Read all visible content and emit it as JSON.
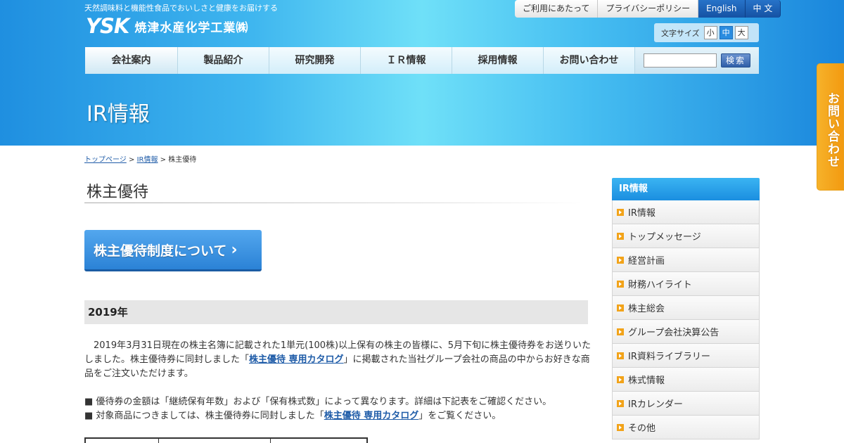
{
  "header": {
    "tagline": "天然調味料と機能性食品でおいしさと健康をお届けする",
    "logo_mark": "YSK",
    "company_name": "焼津水産化学工業㈱",
    "top_links": [
      "ご利用にあたって",
      "プライバシーポリシー",
      "English",
      "中 文"
    ],
    "font_size_label": "文字サイズ",
    "font_sizes": [
      "小",
      "中",
      "大"
    ]
  },
  "global_nav": [
    "会社案内",
    "製品紹介",
    "研究開発",
    "ＩＲ情報",
    "採用情報",
    "お問い合わせ"
  ],
  "search": {
    "placeholder": "",
    "button": "検索"
  },
  "page_title": "IR情報",
  "side_tab": "お問い合わせ",
  "breadcrumb": {
    "home": "トップページ",
    "section": "IR情報",
    "current": "株主優待",
    "sep": ">"
  },
  "main": {
    "heading": "株主優待",
    "cta_label": "株主優待制度について",
    "year": "2019年",
    "para_1": "2019年3月31日現在の株主名簿に記載された1単元(100株)以上保有の株主の皆様に、5月下旬に株主優待券をお送りいたしました。株主優待券に同封しました「",
    "catalog_link": "株主優待 専用カタログ",
    "para_1_end": "」に掲載された当社グループ会社の商品の中からお好きな商品をご注文いただけます。",
    "bullet_1": "■ 優待券の金額は「継続保有年数」および「保有株式数」によって異なります。詳細は下記表をご確認ください。",
    "bullet_2_start": "■ 対象商品につきましては、株主優待券に同封しました「",
    "bullet_2_end": "」をご覧ください。"
  },
  "sidebar": {
    "title": "IR情報",
    "items": [
      "IR情報",
      "トップメッセージ",
      "経営計画",
      "財務ハイライト",
      "株主総会",
      "グループ会社決算公告",
      "IR資料ライブラリー",
      "株式情報",
      "IRカレンダー",
      "その他"
    ]
  },
  "colors": {
    "accent_blue": "#2a8ce0",
    "orange": "#f39a10",
    "link": "#1f5ca8"
  }
}
